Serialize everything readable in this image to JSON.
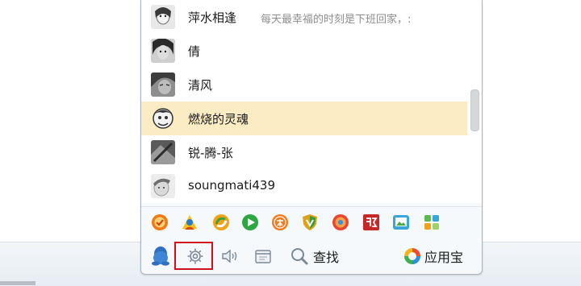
{
  "contacts": [
    {
      "name": "萍水相逢",
      "status": "每天最幸福的时刻是下班回家，:"
    },
    {
      "name": "倩",
      "status": ""
    },
    {
      "name": "清风",
      "status": ""
    },
    {
      "name": "燃烧的灵魂",
      "status": ""
    },
    {
      "name": "锐-腾-张",
      "status": ""
    },
    {
      "name": "soungmati439",
      "status": ""
    }
  ],
  "apps": [
    {
      "icon": "check-app-icon",
      "color": "#f07a12"
    },
    {
      "icon": "person-app-icon",
      "color": "#2a7cc8"
    },
    {
      "icon": "refresh-app-icon",
      "color": "#f0a21a"
    },
    {
      "icon": "play-app-icon",
      "color": "#2da644"
    },
    {
      "icon": "free-app-icon",
      "color": "#f27a1c"
    },
    {
      "icon": "shield-app-icon",
      "color": "#e0a21c"
    },
    {
      "icon": "target-app-icon",
      "color": "#e8462e"
    },
    {
      "icon": "stock-app-icon",
      "color": "#c6282a"
    },
    {
      "icon": "photo-app-icon",
      "color": "#3aa6d8"
    },
    {
      "icon": "grid-app-icon",
      "color": "#5fb84e"
    }
  ],
  "toolbar": {
    "search_label": "查找",
    "appstore_label": "应用宝"
  },
  "colors": {
    "selected_row": "#fbecc4",
    "highlight_border": "#d0111c"
  }
}
